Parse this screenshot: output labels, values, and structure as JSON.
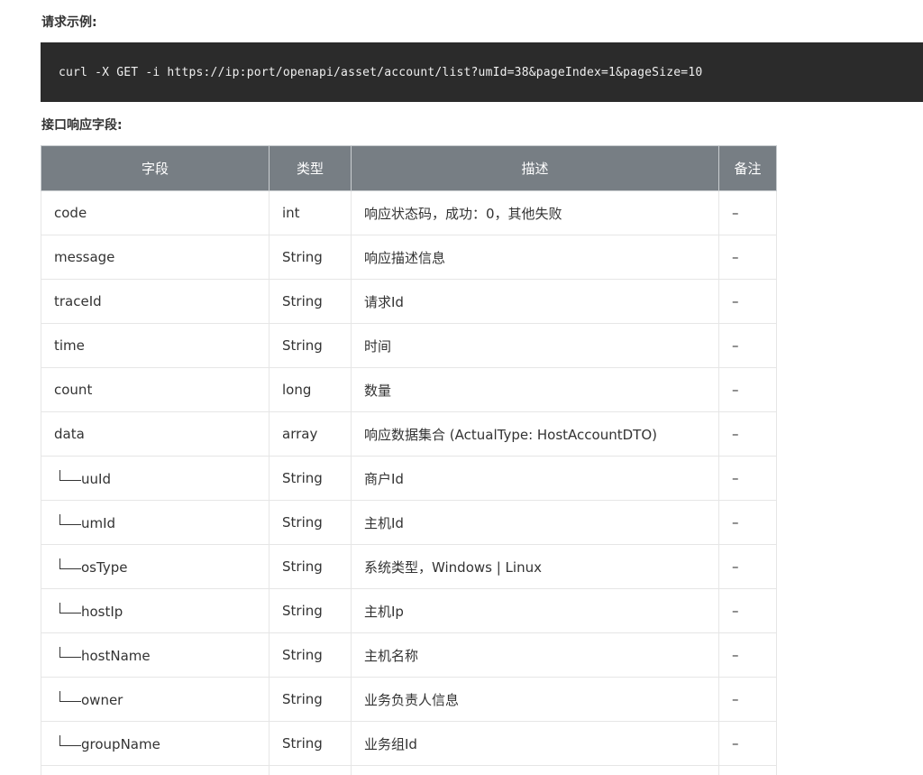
{
  "request_example": {
    "heading": "请求示例:",
    "code": "curl -X GET -i https://ip:port/openapi/asset/account/list?umId=38&pageIndex=1&pageSize=10"
  },
  "response_fields": {
    "heading": "接口响应字段:",
    "columns": [
      "字段",
      "类型",
      "描述",
      "备注"
    ],
    "rows": [
      {
        "field": "code",
        "nested": false,
        "type": "int",
        "desc": "响应状态码，成功：0，其他失败",
        "note": "–"
      },
      {
        "field": "message",
        "nested": false,
        "type": "String",
        "desc": "响应描述信息",
        "note": "–"
      },
      {
        "field": "traceId",
        "nested": false,
        "type": "String",
        "desc": "请求Id",
        "note": "–"
      },
      {
        "field": "time",
        "nested": false,
        "type": "String",
        "desc": "时间",
        "note": "–"
      },
      {
        "field": "count",
        "nested": false,
        "type": "long",
        "desc": "数量",
        "note": "–"
      },
      {
        "field": "data",
        "nested": false,
        "type": "array",
        "desc": "响应数据集合 (ActualType: HostAccountDTO)",
        "note": "–"
      },
      {
        "field": "uuId",
        "nested": true,
        "type": "String",
        "desc": "商户Id",
        "note": "–"
      },
      {
        "field": "umId",
        "nested": true,
        "type": "String",
        "desc": "主机Id",
        "note": "–"
      },
      {
        "field": "osType",
        "nested": true,
        "type": "String",
        "desc": "系统类型，Windows | Linux",
        "note": "–"
      },
      {
        "field": "hostIp",
        "nested": true,
        "type": "String",
        "desc": "主机Ip",
        "note": "–"
      },
      {
        "field": "hostName",
        "nested": true,
        "type": "String",
        "desc": "主机名称",
        "note": "–"
      },
      {
        "field": "owner",
        "nested": true,
        "type": "String",
        "desc": "业务负责人信息",
        "note": "–"
      },
      {
        "field": "groupName",
        "nested": true,
        "type": "String",
        "desc": "业务组Id",
        "note": "–"
      },
      {
        "field": "",
        "nested": false,
        "type": "",
        "desc": "",
        "note": ""
      }
    ]
  }
}
